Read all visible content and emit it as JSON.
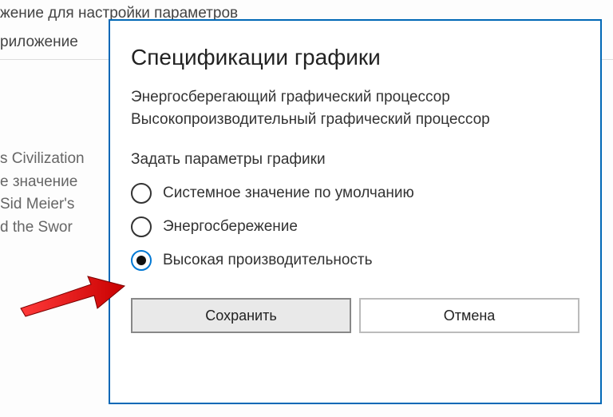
{
  "background": {
    "line1": "жение для настройки параметров",
    "line2": "риложение",
    "block_lines": [
      "s Civilization",
      "е значение",
      "Sid Meier's",
      "d the Swor"
    ]
  },
  "dialog": {
    "title": "Спецификации графики",
    "desc_line1": "Энергосберегающий графический процессор",
    "desc_line2": "Высокопроизводительный графический процессор",
    "subtitle": "Задать параметры графики",
    "options": {
      "0": {
        "label": "Системное значение по умолчанию"
      },
      "1": {
        "label": "Энергосбережение"
      },
      "2": {
        "label": "Высокая производительность"
      }
    },
    "buttons": {
      "save": "Сохранить",
      "cancel": "Отмена"
    }
  }
}
